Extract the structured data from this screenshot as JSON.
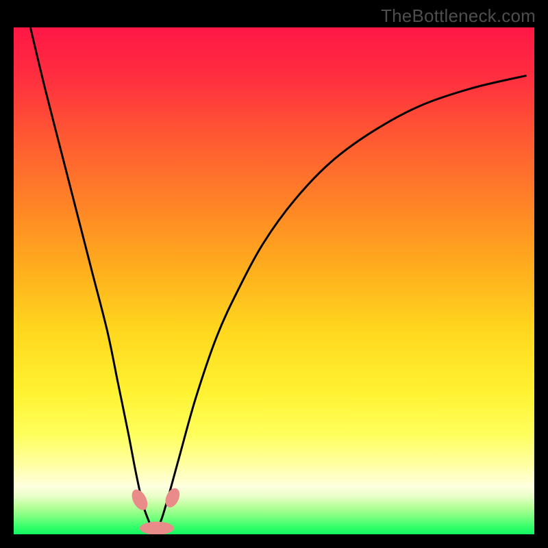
{
  "watermark": "TheBottleneck.com",
  "colors": {
    "black": "#000000",
    "curve": "#000000",
    "marker": "#e98b89",
    "gradient_stops": [
      {
        "offset": 0.0,
        "color": "#ff1746"
      },
      {
        "offset": 0.1,
        "color": "#ff2f3f"
      },
      {
        "offset": 0.22,
        "color": "#ff5a32"
      },
      {
        "offset": 0.35,
        "color": "#ff8426"
      },
      {
        "offset": 0.48,
        "color": "#ffaf1d"
      },
      {
        "offset": 0.6,
        "color": "#ffd81e"
      },
      {
        "offset": 0.72,
        "color": "#fff232"
      },
      {
        "offset": 0.8,
        "color": "#ffff5a"
      },
      {
        "offset": 0.86,
        "color": "#ffffa0"
      },
      {
        "offset": 0.905,
        "color": "#ffffe0"
      },
      {
        "offset": 0.925,
        "color": "#e8ffc8"
      },
      {
        "offset": 0.945,
        "color": "#b8ff9a"
      },
      {
        "offset": 0.965,
        "color": "#7dff80"
      },
      {
        "offset": 0.985,
        "color": "#35ff6a"
      },
      {
        "offset": 1.0,
        "color": "#11f660"
      }
    ]
  },
  "chart_data": {
    "type": "line",
    "title": "",
    "xlabel": "",
    "ylabel": "",
    "xlim": [
      0,
      1
    ],
    "ylim": [
      0,
      1
    ],
    "series": [
      {
        "name": "bottleneck-curve",
        "x": [
          0.032,
          0.06,
          0.09,
          0.12,
          0.15,
          0.18,
          0.2,
          0.22,
          0.235,
          0.248,
          0.258,
          0.266,
          0.274,
          0.284,
          0.3,
          0.32,
          0.35,
          0.39,
          0.43,
          0.48,
          0.54,
          0.61,
          0.69,
          0.78,
          0.88,
          0.985
        ],
        "y": [
          1.0,
          0.88,
          0.76,
          0.64,
          0.52,
          0.4,
          0.3,
          0.2,
          0.12,
          0.06,
          0.03,
          0.012,
          0.012,
          0.03,
          0.085,
          0.16,
          0.27,
          0.39,
          0.48,
          0.575,
          0.66,
          0.735,
          0.795,
          0.845,
          0.88,
          0.905
        ]
      }
    ],
    "markers": [
      {
        "name": "left-lobe-dot",
        "cx": 0.242,
        "cy": 0.068,
        "rx": 0.0125,
        "ry": 0.022,
        "rot": -28
      },
      {
        "name": "right-lobe-dot",
        "cx": 0.305,
        "cy": 0.072,
        "rx": 0.012,
        "ry": 0.02,
        "rot": 24
      },
      {
        "name": "bottom-lobe-blob",
        "cx": 0.275,
        "cy": 0.012,
        "rx": 0.033,
        "ry": 0.013,
        "rot": 0
      }
    ]
  }
}
